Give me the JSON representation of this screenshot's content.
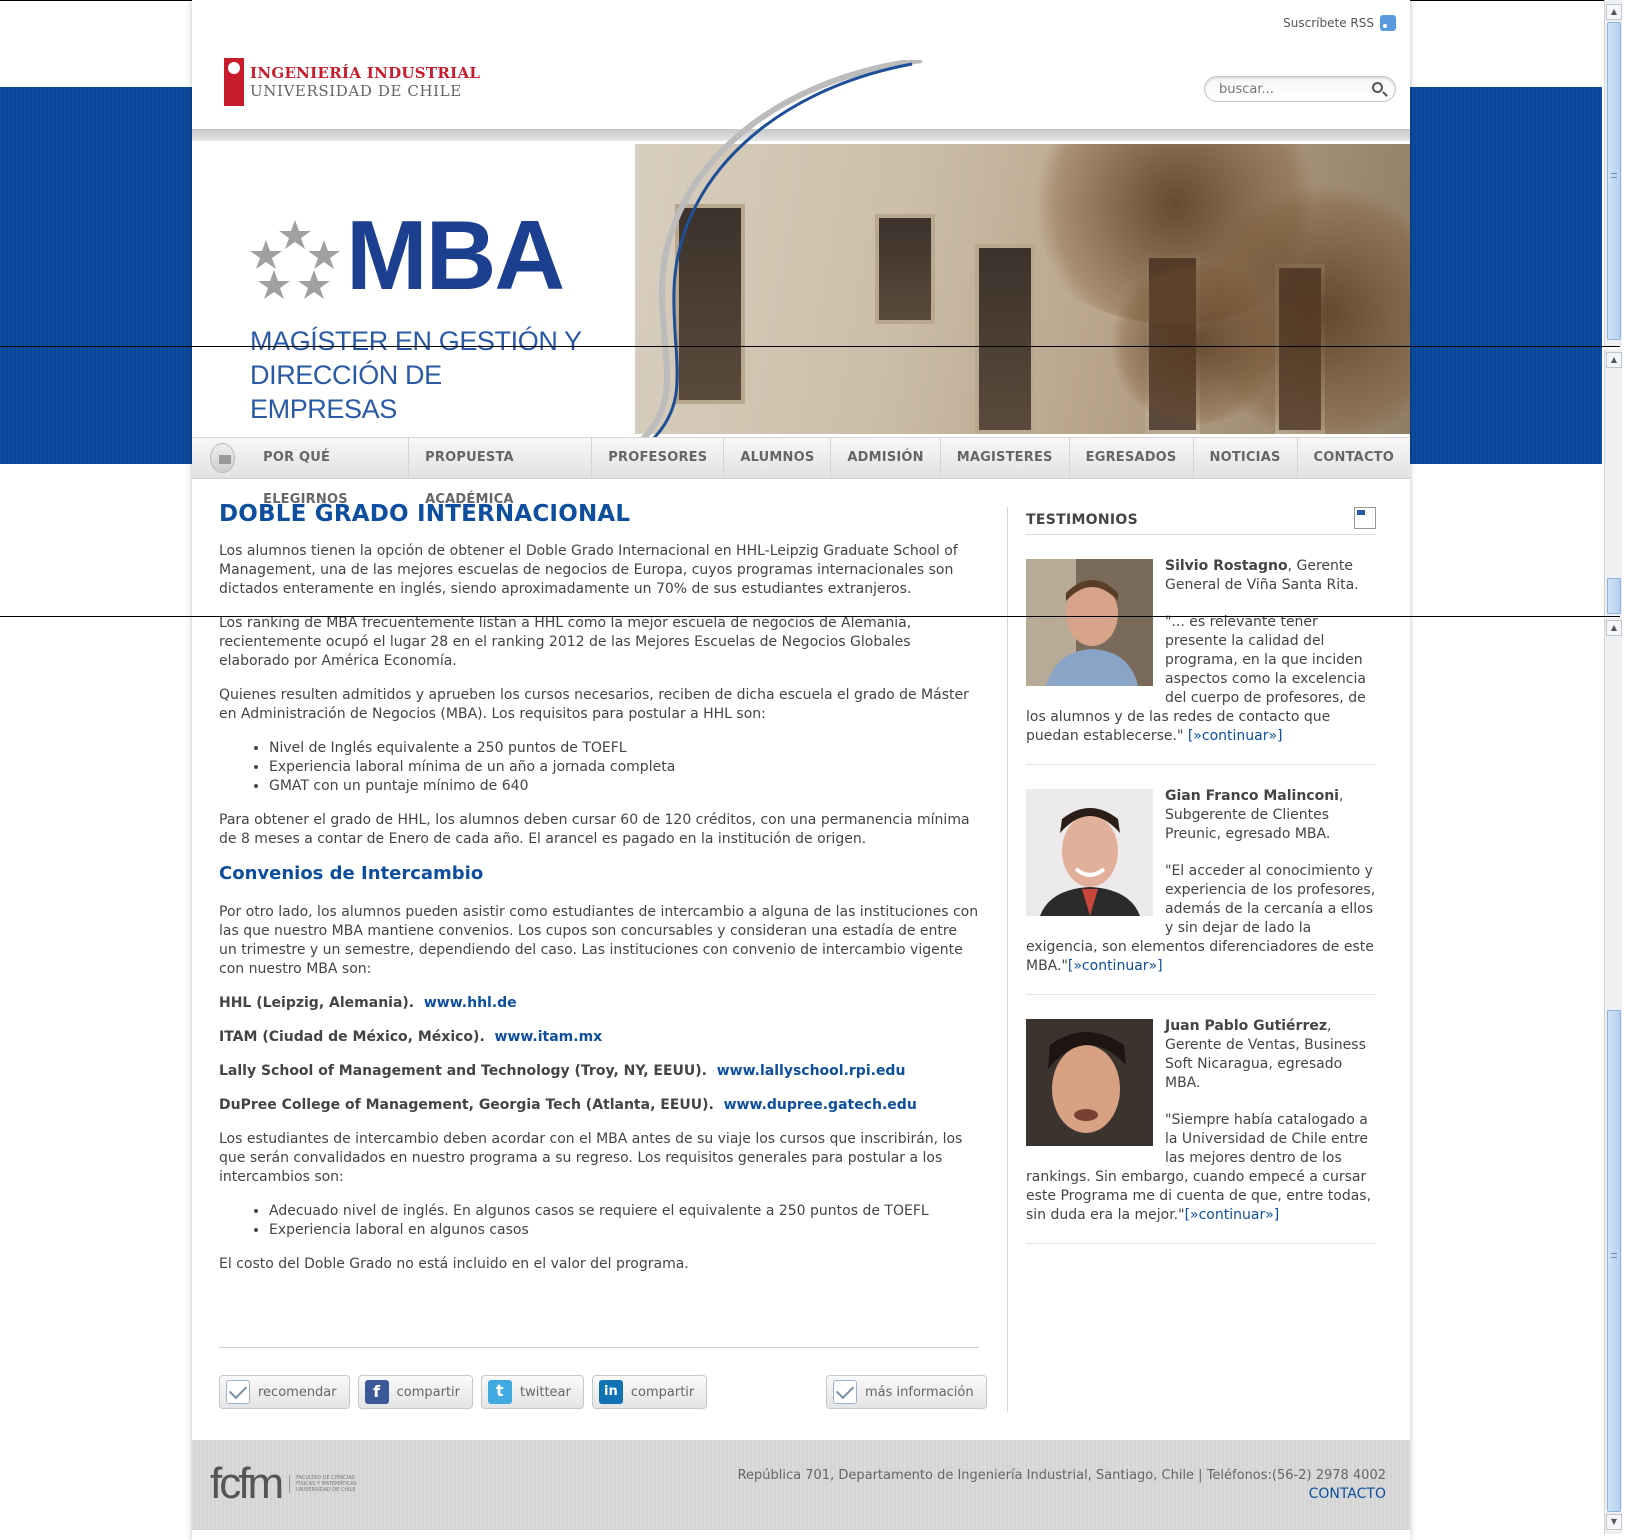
{
  "header": {
    "rss_label": "Suscríbete RSS",
    "logo_line1": "INGENIERÍA INDUSTRIAL",
    "logo_line2": "UNIVERSIDAD DE CHILE",
    "search_placeholder": "buscar..."
  },
  "banner": {
    "mba_title": "MBA",
    "mba_sub1": "MAGÍSTER EN GESTIÓN Y",
    "mba_sub2": "DIRECCIÓN DE EMPRESAS"
  },
  "nav": {
    "items": [
      "POR QUÉ ELEGIRNOS",
      "PROPUESTA ACADÉMICA",
      "PROFESORES",
      "ALUMNOS",
      "ADMISIÓN",
      "MAGISTERES",
      "EGRESADOS",
      "NOTICIAS",
      "CONTACTO"
    ]
  },
  "main": {
    "title": "DOBLE GRADO INTERNACIONAL",
    "p1": "Los alumnos tienen la opción de obtener el Doble Grado Internacional en HHL-Leipzig Graduate School of Management, una de las mejores escuelas de negocios de Europa, cuyos programas internacionales son dictados enteramente en inglés, siendo aproximadamente un 70% de sus estudiantes extranjeros.",
    "p2": "Los ranking de MBA frecuentemente listan a HHL como la mejor escuela de negocios de Alemania, recientemente ocupó el lugar 28 en el ranking 2012 de las Mejores Escuelas de Negocios Globales elaborado por América Economía.",
    "p3": "Quienes resulten admitidos y aprueben los cursos necesarios, reciben de dicha escuela el grado de Máster en Administración de Negocios (MBA). Los requisitos para postular a HHL son:",
    "req": [
      "Nivel de Inglés equivalente a 250 puntos de TOEFL",
      "Experiencia laboral mínima de un año a jornada completa",
      "GMAT con un puntaje mínimo de 640"
    ],
    "p4": "Para obtener el grado de HHL, los alumnos deben cursar 60 de 120 créditos, con una permanencia mínima de 8 meses a contar de Enero de cada año. El arancel es pagado en la institución de origen.",
    "h2": "Convenios de Intercambio",
    "p5": "Por otro lado, los alumnos pueden asistir como estudiantes de intercambio a alguna de las instituciones con las que nuestro MBA mantiene convenios. Los cupos son concursables y consideran una estadía de entre un trimestre y un semestre, dependiendo del caso. Las instituciones con convenio de intercambio vigente con nuestro MBA son:",
    "institutions": [
      {
        "name": "HHL (Leipzig, Alemania).",
        "link": "www.hhl.de"
      },
      {
        "name": "ITAM (Ciudad de México, México).",
        "link": "www.itam.mx"
      },
      {
        "name": "Lally School of Management and Technology (Troy, NY, EEUU).",
        "link": "www.lallyschool.rpi.edu"
      },
      {
        "name": "DuPree College of Management, Georgia Tech (Atlanta, EEUU).",
        "link": "www.dupree.gatech.edu"
      }
    ],
    "p6": "Los estudiantes de intercambio deben acordar con el MBA antes de su viaje los cursos que inscribirán, los que serán convalidados en nuestro programa a su regreso. Los requisitos generales para postular a los intercambios son:",
    "req2": [
      "Adecuado nivel de inglés. En algunos casos se requiere el equivalente a 250 puntos de TOEFL",
      "Experiencia laboral en algunos casos"
    ],
    "p7": "El costo del Doble Grado no está incluido en el valor del programa."
  },
  "share": {
    "recommend": "recomendar",
    "facebook": "compartir",
    "twitter": "twittear",
    "linkedin": "compartir",
    "more_info": "más información"
  },
  "sidebar": {
    "title": "TESTIMONIOS",
    "testimonials": [
      {
        "name": "Silvio Rostagno",
        "role": ", Gerente General de Viña Santa Rita.",
        "quote": "\"... es relevante tener presente la calidad del programa, en la que inciden aspectos como la excelencia del cuerpo de profesores, de los alumnos y de las redes de contacto que puedan establecerse.\"",
        "more": "[»continuar»]"
      },
      {
        "name": "Gian Franco Malinconi",
        "role": ", Subgerente de Clientes Preunic, egresado MBA.",
        "quote": "\"El acceder al conocimiento y experiencia de los profesores, además de la cercanía a ellos y sin dejar de lado la exigencia, son elementos diferenciadores de este MBA.\"",
        "more": "[»continuar»]"
      },
      {
        "name": "Juan Pablo Gutiérrez",
        "role": ", Gerente de Ventas, Business Soft Nicaragua, egresado MBA.",
        "quote": "\"Siempre había catalogado a la Universidad de Chile entre las mejores dentro de los rankings. Sin embargo, cuando empecé a cursar este Programa me di cuenta de que, entre todas, sin duda era la mejor.\"",
        "more": "[»continuar»]"
      }
    ]
  },
  "footer": {
    "logo": "fcfm",
    "logo_small": "FACULTAD DE CIENCIAS FÍSICAS Y MATEMÁTICAS UNIVERSIDAD DE CHILE",
    "address": "República 701, Departamento de Ingeniería Industrial, Santiago, Chile | Teléfonos:(56-2) 2978 4002",
    "contact": "CONTACTO"
  }
}
